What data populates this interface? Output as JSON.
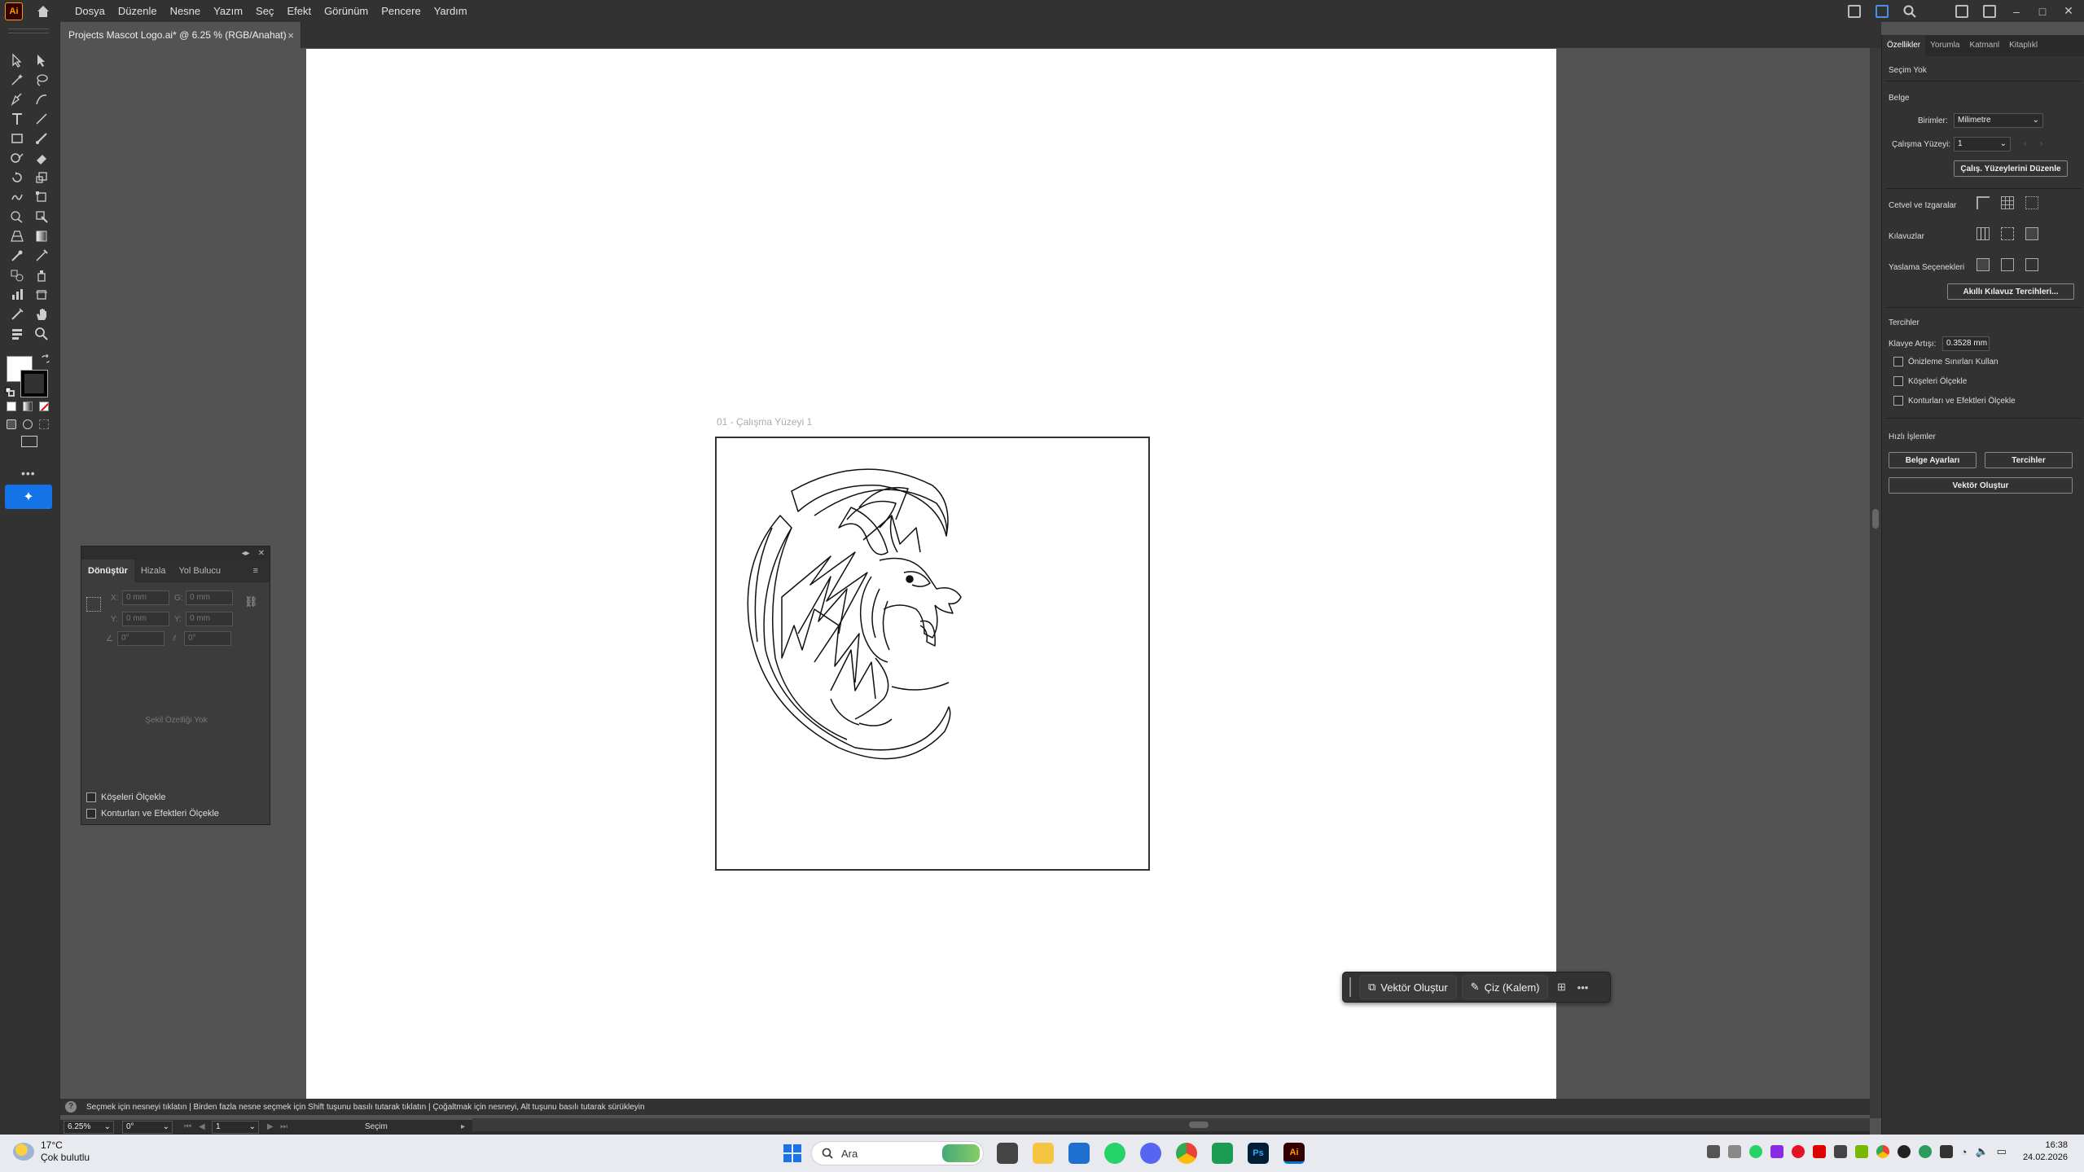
{
  "app": {
    "logo": "Ai",
    "menus": [
      "Dosya",
      "Düzenle",
      "Nesne",
      "Yazım",
      "Seç",
      "Efekt",
      "Görünüm",
      "Pencere",
      "Yardım"
    ]
  },
  "document": {
    "tab_title": "Projects Mascot Logo.ai* @ 6.25 % (RGB/Anahat)",
    "close": "×",
    "artboard_label": "01 - Çalışma Yüzeyi 1"
  },
  "context_bar": {
    "vector_button": "Vektör Oluştur",
    "draw_button": "Çiz (Kalem)",
    "more": "•••"
  },
  "transform_panel": {
    "tabs": [
      "Dönüştür",
      "Hizala",
      "Yol Bulucu"
    ],
    "x_label": "X:",
    "x_value": "0 mm",
    "w_label": "G:",
    "w_value": "0 mm",
    "y_label": "Y:",
    "y_value": "0 mm",
    "h_label": "Y:",
    "h_value": "0 mm",
    "angle_value": "0°",
    "shear_value": "0°",
    "no_shape": "Şekil Özelliği Yok",
    "check_corners": "Köşeleri Ölçekle",
    "check_strokes": "Konturları ve Efektleri Ölçekle"
  },
  "properties": {
    "tabs": [
      "Özellikler",
      "Yorumla",
      "Katmanl",
      "Kitaplıkl"
    ],
    "selection": "Seçim Yok",
    "document_heading": "Belge",
    "units_label": "Birimler:",
    "units_value": "Milimetre",
    "artboard_label": "Çalışma Yüzeyi:",
    "artboard_value": "1",
    "edit_artboards_button": "Çalış. Yüzeylerini Düzenle",
    "rulers_label": "Cetvel ve Izgaralar",
    "guides_label": "Kılavuzlar",
    "snap_label": "Yaslama Seçenekleri",
    "smart_guides_button": "Akıllı Kılavuz Tercihleri...",
    "prefs_heading": "Tercihler",
    "keyboard_inc_label": "Klavye Artışı:",
    "keyboard_inc_value": "0.3528 mm",
    "check_preview": "Önizleme Sınırları Kullan",
    "check_corners": "Köşeleri Ölçekle",
    "check_strokes": "Konturları ve Efektleri Ölçekle",
    "quick_actions": "Hızlı İşlemler",
    "doc_setup_button": "Belge Ayarları",
    "prefs_button": "Tercihler",
    "vectorize_button": "Vektör Oluştur"
  },
  "status": {
    "hint": "Seçmek için nesneyi tıklatın  |  Birden fazla nesne seçmek için Shift tuşunu basılı tutarak tıklatın  |  Çoğaltmak için nesneyi, Alt tuşunu basılı tutarak sürükleyin",
    "zoom": "6.25%",
    "rotation": "0°",
    "artboard_num": "1",
    "tool": "Seçim"
  },
  "taskbar": {
    "temp": "17°C",
    "weather": "Çok bulutlu",
    "search": "Ara",
    "time": "16:38",
    "date": "24.02.2026"
  }
}
